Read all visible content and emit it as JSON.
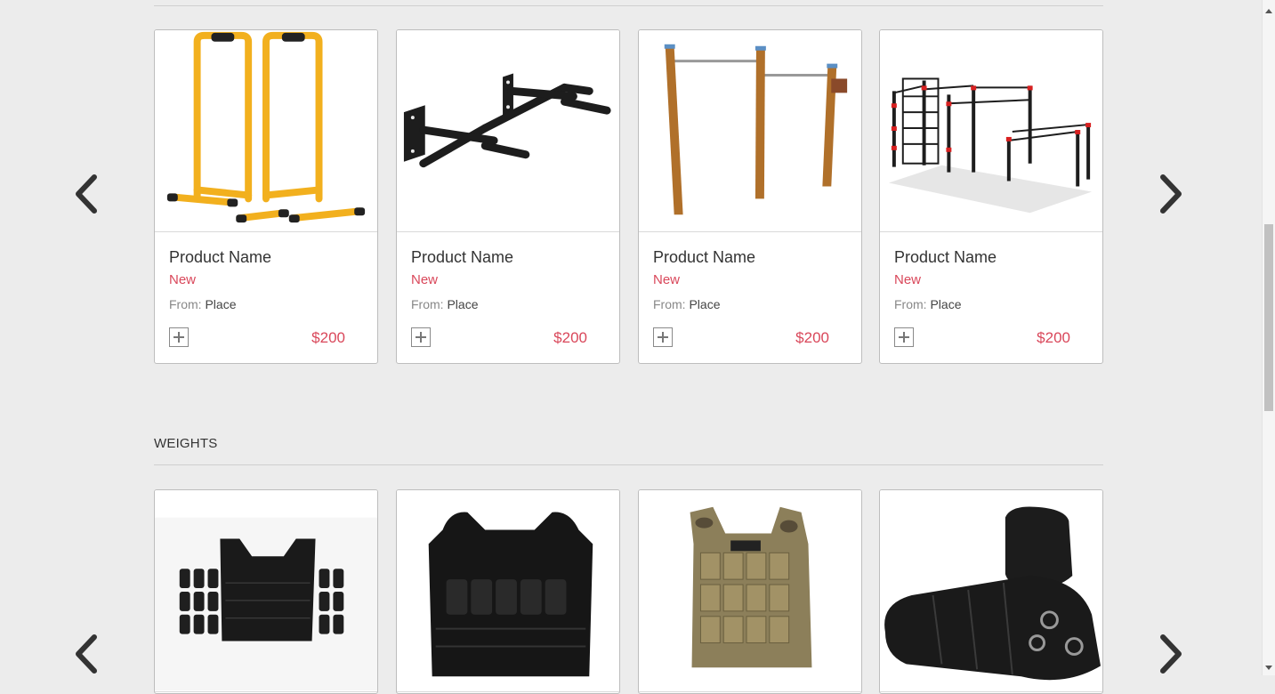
{
  "categories": {
    "weights_title": "WEIGHTS"
  },
  "bars_row": {
    "products": [
      {
        "name": "Product Name",
        "badge": "New",
        "from_label": "From:",
        "place": "Place",
        "price": "$200",
        "image": "yellow-dip-bars"
      },
      {
        "name": "Product Name",
        "badge": "New",
        "from_label": "From:",
        "place": "Place",
        "price": "$200",
        "image": "wall-pull-up-bar"
      },
      {
        "name": "Product Name",
        "badge": "New",
        "from_label": "From:",
        "place": "Place",
        "price": "$200",
        "image": "wooden-pull-up-posts"
      },
      {
        "name": "Product Name",
        "badge": "New",
        "from_label": "From:",
        "place": "Place",
        "price": "$200",
        "image": "outdoor-calisthenics-station"
      }
    ]
  },
  "weights_row": {
    "products": [
      {
        "image": "weight-vest-with-plates"
      },
      {
        "image": "black-weight-vest"
      },
      {
        "image": "camo-weight-vest"
      },
      {
        "image": "ankle-weights"
      }
    ]
  },
  "icons": {
    "prev": "chevron-left-icon",
    "next": "chevron-right-icon",
    "add": "plus-icon"
  },
  "colors": {
    "accent": "#d9475a",
    "background": "#ececec",
    "card": "#ffffff",
    "yellow_bar": "#f2b01e",
    "wood": "#b0702a"
  }
}
